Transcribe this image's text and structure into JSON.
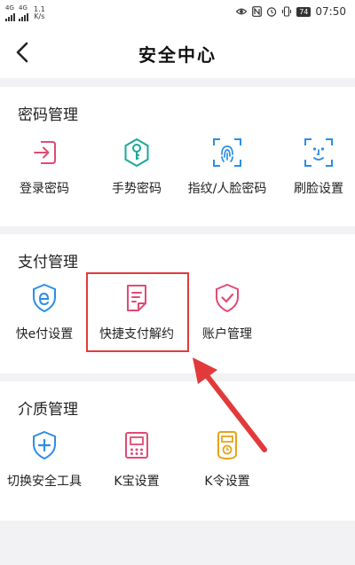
{
  "status_bar": {
    "network_1": "4G",
    "network_2": "4G",
    "speed_value": "1.1",
    "speed_unit": "K/s",
    "battery": "74",
    "time": "07:50"
  },
  "header": {
    "title": "安全中心"
  },
  "sections": [
    {
      "title": "密码管理",
      "items": [
        {
          "label": "登录密码",
          "icon": "login-icon"
        },
        {
          "label": "手势密码",
          "icon": "key-hexagon-icon"
        },
        {
          "label": "指纹/人脸密码",
          "icon": "fingerprint-icon"
        },
        {
          "label": "刷脸设置",
          "icon": "face-scan-icon"
        }
      ]
    },
    {
      "title": "支付管理",
      "items": [
        {
          "label": "快e付设置",
          "icon": "shield-e-icon"
        },
        {
          "label": "快捷支付解约",
          "icon": "document-icon"
        },
        {
          "label": "账户管理",
          "icon": "shield-check-icon"
        }
      ]
    },
    {
      "title": "介质管理",
      "items": [
        {
          "label": "切换安全工具",
          "icon": "shield-plus-icon"
        },
        {
          "label": "K宝设置",
          "icon": "usb-key-icon"
        },
        {
          "label": "K令设置",
          "icon": "token-icon"
        }
      ]
    }
  ],
  "annotation": {
    "highlight_color": "#e23a3a"
  }
}
